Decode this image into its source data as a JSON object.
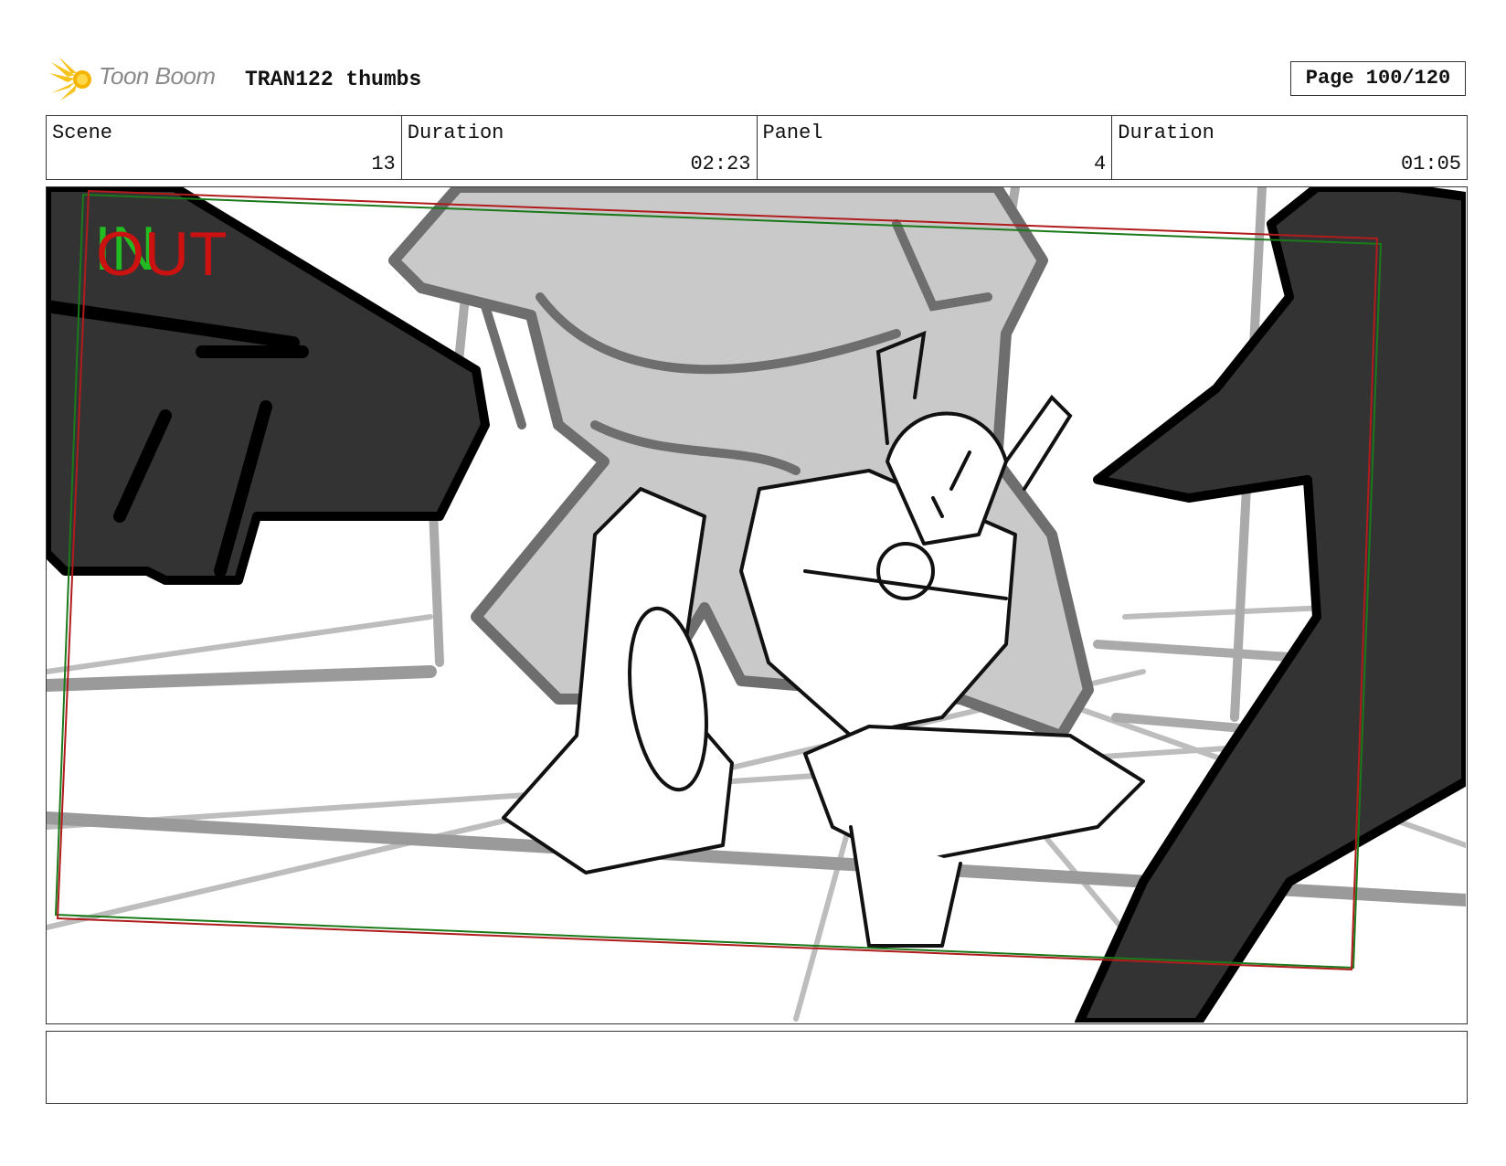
{
  "header": {
    "logo_text": "Toon Boom",
    "title": "TRAN122 thumbs",
    "page_label": "Page 100/120"
  },
  "info": {
    "scene_label": "Scene",
    "scene_value": "13",
    "scene_duration_label": "Duration",
    "scene_duration_value": "02:23",
    "panel_label": "Panel",
    "panel_value": "4",
    "panel_duration_label": "Duration",
    "panel_duration_value": "01:05"
  },
  "panel": {
    "in_marker": "IN",
    "out_marker": "OUT",
    "colors": {
      "in_frame": "#1a7a1a",
      "out_frame": "#b01c1c",
      "in_text": "#22bb22",
      "out_text": "#cc1111"
    }
  },
  "notes": {
    "text": ""
  }
}
